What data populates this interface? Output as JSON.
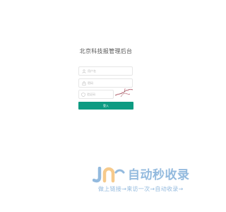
{
  "login": {
    "title": "北京科技报管理后台",
    "username_placeholder": "用户名",
    "password_placeholder": "密码",
    "captcha_placeholder": "验证码",
    "submit_label": "登入"
  },
  "icons": {
    "username": "user-icon",
    "password": "lock-icon",
    "captcha": "shield-icon"
  },
  "colors": {
    "button": "#0d9b82",
    "watermark": "#3b82c4"
  },
  "watermark": {
    "name": "自动秒收录",
    "slogan": "做上链接→来访一次→自动收录→"
  }
}
